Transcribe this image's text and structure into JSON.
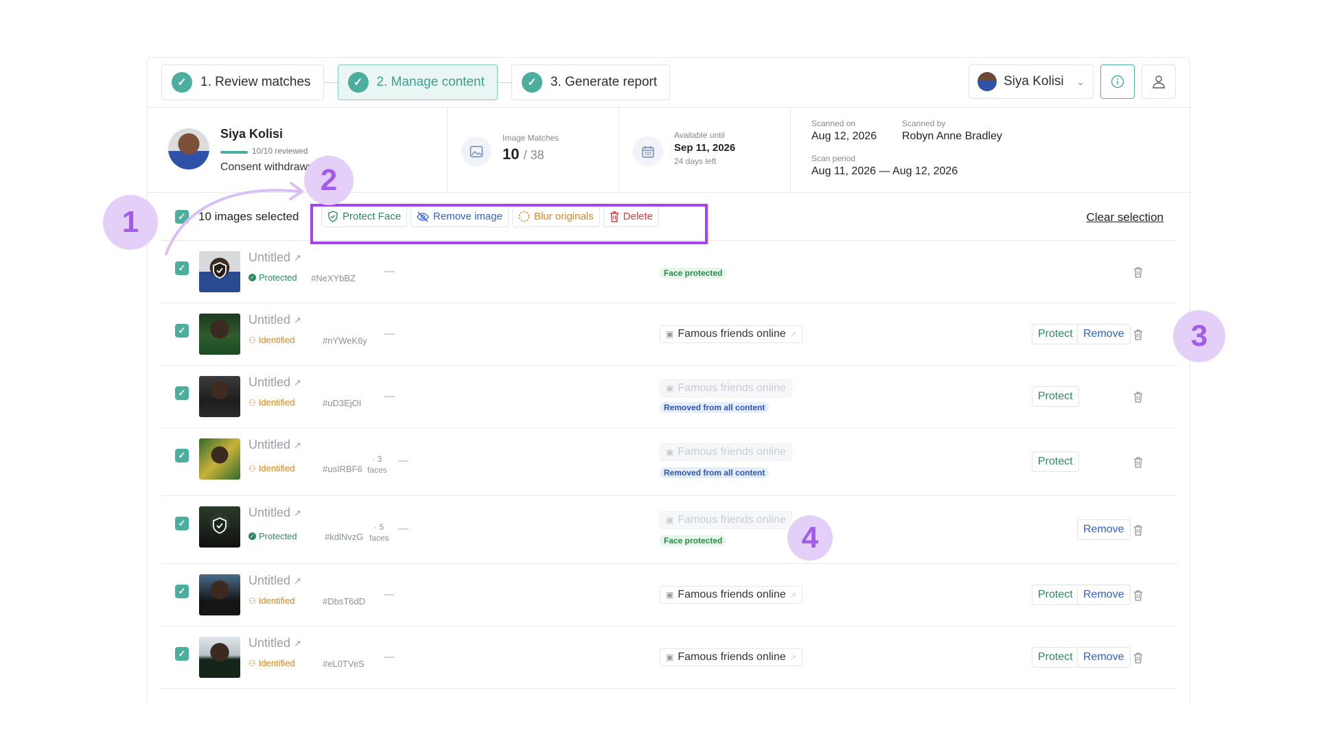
{
  "stepper": {
    "steps": [
      {
        "label": "1. Review matches"
      },
      {
        "label": "2. Manage content"
      },
      {
        "label": "3. Generate report"
      }
    ]
  },
  "header": {
    "user_name": "Siya Kolisi"
  },
  "summary": {
    "name": "Siya Kolisi",
    "reviewed": "10/10 reviewed",
    "progress_fraction": 1.0,
    "consent": "Consent withdrawn",
    "image_matches_label": "Image Matches",
    "image_matches_value": "10",
    "image_matches_total": "/ 38",
    "available_label": "Available until",
    "available_date": "Sep 11, 2026",
    "days_left": "24 days left",
    "scanned_on_label": "Scanned on",
    "scanned_on": "Aug 12, 2026",
    "scanned_by_label": "Scanned by",
    "scanned_by": "Robyn Anne Bradley",
    "scan_period_label": "Scan period",
    "scan_period": "Aug 11, 2026 — Aug 12, 2026"
  },
  "selection": {
    "count_label": "10 images selected",
    "protect_face": "Protect Face",
    "remove_image": "Remove image",
    "blur_originals": "Blur originals",
    "delete": "Delete",
    "clear": "Clear selection"
  },
  "rows": [
    {
      "title": "Untitled",
      "status": "Protected",
      "hash": "#NeXYbBZ",
      "dash": "—",
      "source": "",
      "tag": "Face protected",
      "protect": "",
      "remove": ""
    },
    {
      "title": "Untitled",
      "status": "Identified",
      "hash": "#nYWeK6y",
      "dash": "—",
      "source": "Famous friends online",
      "tag": "",
      "protect": "Protect",
      "remove": "Remove"
    },
    {
      "title": "Untitled",
      "status": "Identified",
      "hash": "#uD3EjOI",
      "dash": "—",
      "source": "Famous friends online",
      "tag": "Removed from all content",
      "protect": "Protect",
      "remove": ""
    },
    {
      "title": "Untitled",
      "status": "Identified",
      "hash": "#usIRBF6",
      "faces_n": "· 3",
      "faces_l": "faces",
      "dash": "—",
      "source": "Famous friends online",
      "tag": "Removed from all content",
      "protect": "Protect",
      "remove": ""
    },
    {
      "title": "Untitled",
      "status": "Protected",
      "hash": "#kdlNvzG",
      "faces_n": "· 5",
      "faces_l": "faces",
      "dash": "—",
      "source": "Famous friends online",
      "tag": "Face protected",
      "protect": "",
      "remove": "Remove"
    },
    {
      "title": "Untitled",
      "status": "Identified",
      "hash": "#DbsT6dD",
      "dash": "—",
      "source": "Famous friends online",
      "tag": "",
      "protect": "Protect",
      "remove": "Remove"
    },
    {
      "title": "Untitled",
      "status": "Identified",
      "hash": "#eL0TVeS",
      "dash": "—",
      "source": "Famous friends online",
      "tag": "",
      "protect": "Protect",
      "remove": "Remove"
    }
  ],
  "annotations": [
    "1",
    "2",
    "3",
    "4"
  ],
  "colors": {
    "accent": "#4cae9f",
    "annotation": "#a742ee",
    "protect": "#2d8a5c",
    "remove": "#2f5fd0",
    "blur": "#d7871a",
    "delete": "#d83b3b"
  }
}
